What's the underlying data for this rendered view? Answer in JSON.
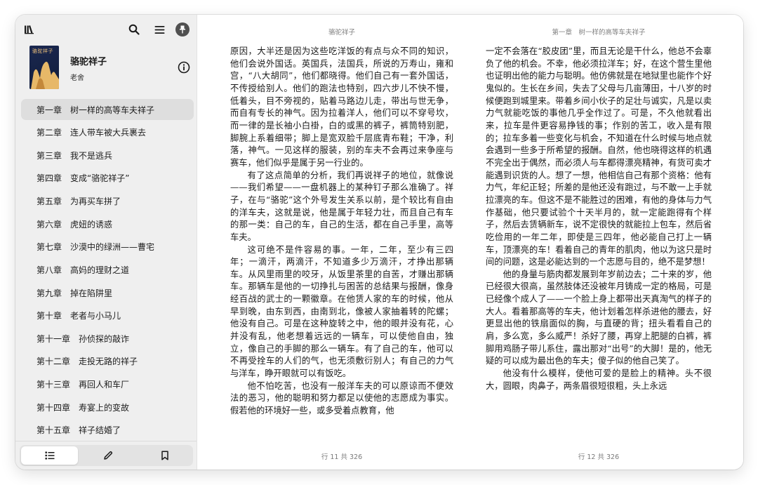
{
  "book": {
    "title": "骆驼祥子",
    "author": "老舍",
    "cover_title": "骆驼祥子"
  },
  "toolbar": {
    "library_icon": "library-icon",
    "search_icon": "search-icon",
    "menu_icon": "menu-icon",
    "pin_icon": "pin-icon",
    "info_icon": "info-icon"
  },
  "toc": [
    {
      "num": "第一章",
      "title": "树一样的高等车夫祥子",
      "active": true
    },
    {
      "num": "第二章",
      "title": "连人带车被大兵裹去"
    },
    {
      "num": "第三章",
      "title": "我不是逃兵"
    },
    {
      "num": "第四章",
      "title": "变成“骆驼祥子”"
    },
    {
      "num": "第五章",
      "title": "为再买车拼了"
    },
    {
      "num": "第六章",
      "title": "虎妞的诱惑"
    },
    {
      "num": "第七章",
      "title": "沙漠中的绿洲——曹宅"
    },
    {
      "num": "第八章",
      "title": "高妈的理财之道"
    },
    {
      "num": "第九章",
      "title": "掉在陷阱里"
    },
    {
      "num": "第十章",
      "title": "老者与小马儿"
    },
    {
      "num": "第十一章",
      "title": "孙侦探的敲诈"
    },
    {
      "num": "第十二章",
      "title": "走投无路的祥子"
    },
    {
      "num": "第十三章",
      "title": "再回人和车厂"
    },
    {
      "num": "第十四章",
      "title": "寿宴上的变故"
    },
    {
      "num": "第十五章",
      "title": "祥子结婚了"
    }
  ],
  "bottom_tabs": [
    {
      "name": "toc-tab",
      "icon": "list-icon",
      "active": true
    },
    {
      "name": "notes-tab",
      "icon": "pencil-icon"
    },
    {
      "name": "bookmarks-tab",
      "icon": "bookmark-icon"
    }
  ],
  "left_page": {
    "header": "骆驼祥子",
    "footer": "行 11 共 326",
    "paragraphs": [
      {
        "indent": false,
        "text": "原因，大半还是因为这些吃洋饭的有点与众不同的知识，他们会说外国话。英国兵，法国兵，所说的万寿山，雍和宫，“八大胡同”，他们都晓得。他们自己有一套外国话，不传授给别人。他们的跑法也特别，四六步儿不快不慢，低着头，目不旁视的，贴着马路边儿走，带出与世无争，而自有专长的神气。因为拉着洋人，他们可以不穿号坎，而一律的是长袖小白褂，白的或黑的裤子，裤筒特别肥，脚腕上系着细带；脚上是宽双脸千层底青布鞋；干净，利落，神气。一见这样的服装，别的车夫不会再过来争座与赛车，他们似乎是属于另一行业的。"
      },
      {
        "indent": true,
        "text": "有了这点简单的分析，我们再说祥子的地位，就像说——我们希望——一盘机器上的某种钉子那么准确了。祥子，在与“骆驼”这个外号发生关系以前，是个较比有自由的洋车夫，这就是说，他是属于年轻力壮，而且自己有车的那一类：自己的车，自己的生活，都在自己手里，高等车夫。"
      },
      {
        "indent": true,
        "text": "这可绝不是件容易的事。一年，二年，至少有三四年；一滴汗，两滴汗，不知道多少万滴汗，才挣出那辆车。从风里雨里的咬牙，从饭里茶里的自苦，才赚出那辆车。那辆车是他的一切挣扎与困苦的总结果与报酬，像身经百战的武士的一颗徽章。在他赁人家的车的时候，他从早到晚，由东到西，由南到北，像被人家抽着转的陀螺；他没有自己。可是在这种旋转之中，他的眼并没有花，心并没有乱，他老想着远远的一辆车，可以使他自由，独立，像自己的手脚的那么一辆车。有了自己的车，他可以不再受拴车的人们的气，也无须敷衍别人；有自己的力气与洋车，睁开眼就可以有饭吃。"
      },
      {
        "indent": true,
        "text": "他不怕吃苦，也没有一般洋车夫的可以原谅而不便效法的恶习，他的聪明和努力都足以使他的志愿成为事实。假若他的环境好一些，或多受着点教育，他"
      }
    ]
  },
  "right_page": {
    "header": "第一章　树一样的高等车夫祥子",
    "footer": "行 12 共 326",
    "paragraphs": [
      {
        "indent": false,
        "text": "一定不会落在“胶皮团”里，而且无论是干什么，他总不会辜负了他的机会。不幸，他必须拉洋车；好，在这个营生里他也证明出他的能力与聪明。他仿佛就是在地狱里也能作个好鬼似的。生长在乡间，失去了父母与几亩薄田，十八岁的时候便跑到城里来。带着乡间小伙子的足壮与诚实，凡是以卖力气就能吃饭的事他几乎全作过了。可是，不久他就看出来，拉车是件更容易挣钱的事；作别的苦工，收入是有限的；拉车多着一些变化与机会，不知道在什么时候与地点就会遇到一些多于所希望的报酬。自然，他也晓得这样的机遇不完全出于偶然，而必须人与车都得漂亮精神，有货可卖才能遇到识货的人。想了一想，他相信自己有那个资格：他有力气，年纪正轻；所差的是他还没有跑过，与不敢一上手就拉漂亮的车。但这不是不能胜过的困难，有他的身体与力气作基础，他只要试验个十天半月的，就一定能跑得有个样子，然后去赁辆新车，说不定很快的就能拉上包车，然后省吃俭用的一年二年，即使是三四年，他必能自己打上一辆车，顶漂亮的车！看着自己的青年的肌肉，他以为这只是时间的问题，这是必能达到的一个志愿与目的，绝不是梦想！"
      },
      {
        "indent": true,
        "text": "他的身量与筋肉都发展到年岁前边去；二十来的岁，他已经很大很高，虽然肢体还没被年月铸成一定的格局，可是已经像个成人了——一个脸上身上都带出天真淘气的样子的大人。看着那高等的车夫，他计划着怎样杀进他的腰去，好更显出他的铁扇面似的胸，与直硬的背；扭头看看自己的肩，多么宽，多么威严！杀好了腰，再穿上肥腿的白裤，裤脚用鸡肠子带儿系住，露出那对“出号”的大脚！是的，他无疑的可以成为最出色的车夫；傻子似的他自己笑了。"
      },
      {
        "indent": true,
        "text": "他没有什么模样，使他可爱的是脸上的精神。头不很大，圆眼，肉鼻子，两条眉很短很粗，头上永远"
      }
    ]
  }
}
